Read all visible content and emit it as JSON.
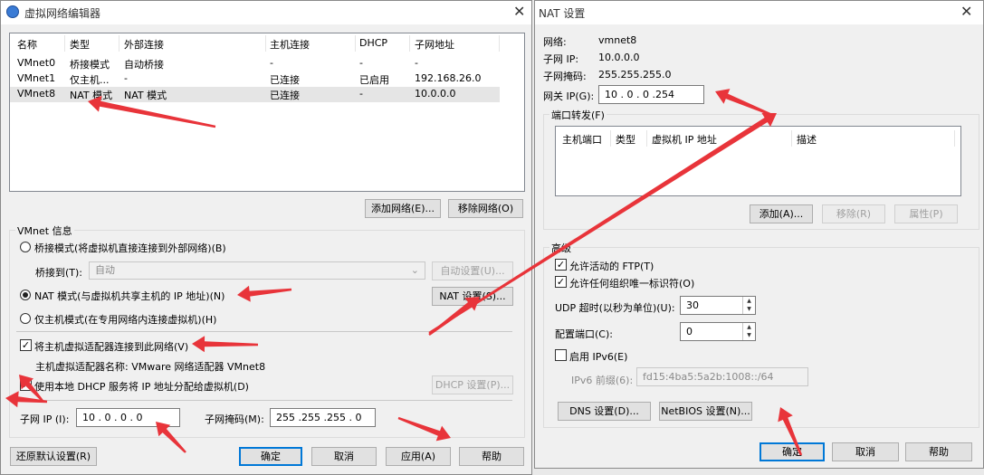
{
  "vne": {
    "title": "虚拟网络编辑器",
    "columns": [
      "名称",
      "类型",
      "外部连接",
      "主机连接",
      "DHCP",
      "子网地址"
    ],
    "rows": [
      [
        "VMnet0",
        "桥接模式",
        "自动桥接",
        "-",
        "-",
        "-"
      ],
      [
        "VMnet1",
        "仅主机...",
        "-",
        "已连接",
        "已启用",
        "192.168.26.0"
      ],
      [
        "VMnet8",
        "NAT 模式",
        "NAT 模式",
        "已连接",
        "-",
        "10.0.0.0"
      ]
    ],
    "add_network": "添加网络(E)...",
    "remove_network": "移除网络(O)",
    "info_title": "VMnet 信息",
    "bridge_mode": "桥接模式(将虚拟机直接连接到外部网络)(B)",
    "bridge_to_label": "桥接到(T):",
    "bridge_to_value": "自动",
    "auto_settings": "自动设置(U)...",
    "nat_mode": "NAT 模式(与虚拟机共享主机的 IP 地址)(N)",
    "nat_settings": "NAT 设置(S)...",
    "host_only": "仅主机模式(在专用网络内连接虚拟机)(H)",
    "connect_adapter": "将主机虚拟适配器连接到此网络(V)",
    "adapter_name": "主机虚拟适配器名称: VMware 网络适配器 VMnet8",
    "use_dhcp": "使用本地 DHCP 服务将 IP 地址分配给虚拟机(D)",
    "dhcp_settings": "DHCP 设置(P)...",
    "subnet_ip_label": "子网 IP (I):",
    "subnet_ip": "10 .  0  .  0  .  0",
    "subnet_mask_label": "子网掩码(M):",
    "subnet_mask": "255 .255 .255 .  0",
    "restore_default": "还原默认设置(R)",
    "ok": "确定",
    "cancel": "取消",
    "apply": "应用(A)",
    "help": "帮助"
  },
  "nat": {
    "title": "NAT 设置",
    "network_label": "网络:",
    "network_value": "vmnet8",
    "subnet_ip_label": "子网 IP:",
    "subnet_ip_value": "10.0.0.0",
    "subnet_mask_label": "子网掩码:",
    "subnet_mask_value": "255.255.255.0",
    "gateway_label": "网关 IP(G):",
    "gateway_value": "10  .  0  .  0  .254",
    "port_forward_title": "端口转发(F)",
    "pf_columns": [
      "主机端口",
      "类型",
      "虚拟机 IP 地址",
      "描述"
    ],
    "add": "添加(A)...",
    "remove": "移除(R)",
    "properties": "属性(P)",
    "advanced_title": "高级",
    "allow_ftp": "允许活动的 FTP(T)",
    "allow_oui": "允许任何组织唯一标识符(O)",
    "udp_label": "UDP 超时(以秒为单位)(U):",
    "udp_value": "30",
    "config_port_label": "配置端口(C):",
    "config_port_value": "0",
    "enable_ipv6": "启用 IPv6(E)",
    "ipv6_prefix_label": "IPv6 前缀(6):",
    "ipv6_prefix_value": "fd15:4ba5:5a2b:1008::/64",
    "dns_settings": "DNS 设置(D)...",
    "netbios_settings": "NetBIOS 设置(N)...",
    "ok": "确定",
    "cancel": "取消",
    "help": "帮助"
  },
  "colors": {
    "annotation": "#e8343a",
    "selected_row": "#e5e5e5",
    "primary_border": "#0078d7"
  }
}
